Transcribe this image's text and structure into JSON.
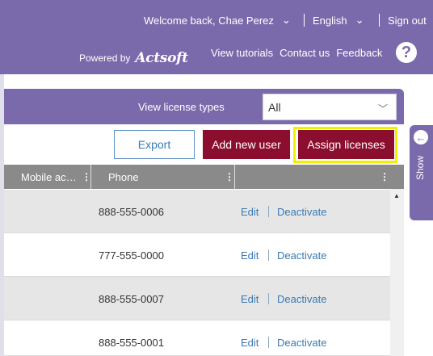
{
  "header": {
    "welcome": "Welcome back, Chae Perez",
    "language": "English",
    "sign_out": "Sign out",
    "powered_by": "Powered by",
    "brand": "Actsoft",
    "links": [
      "View tutorials",
      "Contact us",
      "Feedback"
    ],
    "help_icon": "?"
  },
  "filter": {
    "label": "View license types",
    "selected": "All"
  },
  "toolbar": {
    "export": "Export",
    "add_user": "Add new user",
    "assign_licenses": "Assign licenses"
  },
  "table": {
    "columns": [
      "Mobile ac…",
      "Phone",
      ""
    ],
    "rows": [
      {
        "phone": "888-555-0006",
        "edit": "Edit",
        "deactivate": "Deactivate"
      },
      {
        "phone": "777-555-0000",
        "edit": "Edit",
        "deactivate": "Deactivate"
      },
      {
        "phone": "888-555-0007",
        "edit": "Edit",
        "deactivate": "Deactivate"
      },
      {
        "phone": "888-555-0001",
        "edit": "Edit",
        "deactivate": "Deactivate"
      }
    ]
  },
  "side_panel": {
    "label": "Show"
  },
  "colors": {
    "header_purple": "#7b6aab",
    "button_maroon": "#8b0e2e",
    "link_blue": "#3a7ab3",
    "highlight_yellow": "#f2ef00"
  }
}
